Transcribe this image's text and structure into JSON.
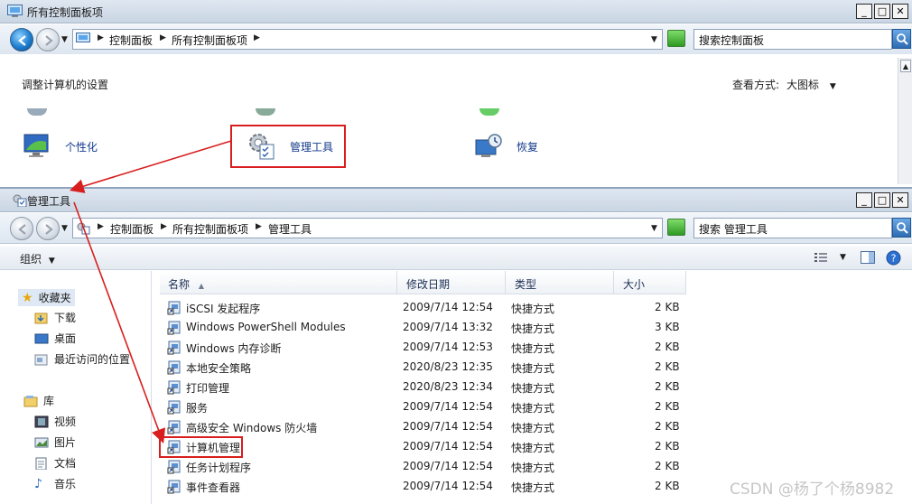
{
  "back_window": {
    "title": "所有控制面板项",
    "breadcrumb": [
      "控制面板",
      "所有控制面板项"
    ],
    "search_placeholder": "搜索控制面板",
    "heading": "调整计算机的设置",
    "view_label": "查看方式:",
    "view_value": "大图标",
    "items": [
      {
        "label": "个性化",
        "icon": "personalization-icon"
      },
      {
        "label": "管理工具",
        "icon": "admin-tools-icon"
      },
      {
        "label": "恢复",
        "icon": "recovery-icon"
      }
    ]
  },
  "front_window": {
    "title": "管理工具",
    "breadcrumb": [
      "控制面板",
      "所有控制面板项",
      "管理工具"
    ],
    "search_placeholder": "搜索 管理工具",
    "organize_label": "组织",
    "nav": {
      "favorites": "收藏夹",
      "favorite_items": [
        "下载",
        "桌面",
        "最近访问的位置"
      ],
      "library": "库",
      "library_items": [
        "视频",
        "图片",
        "文档",
        "音乐"
      ]
    },
    "columns": {
      "name": "名称",
      "modified": "修改日期",
      "type": "类型",
      "size": "大小"
    },
    "files": [
      {
        "name": "iSCSI 发起程序",
        "modified": "2009/7/14 12:54",
        "type": "快捷方式",
        "size": "2 KB"
      },
      {
        "name": "Windows PowerShell Modules",
        "modified": "2009/7/14 13:32",
        "type": "快捷方式",
        "size": "3 KB"
      },
      {
        "name": "Windows 内存诊断",
        "modified": "2009/7/14 12:53",
        "type": "快捷方式",
        "size": "2 KB"
      },
      {
        "name": "本地安全策略",
        "modified": "2020/8/23 12:35",
        "type": "快捷方式",
        "size": "2 KB"
      },
      {
        "name": "打印管理",
        "modified": "2020/8/23 12:34",
        "type": "快捷方式",
        "size": "2 KB"
      },
      {
        "name": "服务",
        "modified": "2009/7/14 12:54",
        "type": "快捷方式",
        "size": "2 KB"
      },
      {
        "name": "高级安全 Windows 防火墙",
        "modified": "2009/7/14 12:54",
        "type": "快捷方式",
        "size": "2 KB"
      },
      {
        "name": "计算机管理",
        "modified": "2009/7/14 12:54",
        "type": "快捷方式",
        "size": "2 KB"
      },
      {
        "name": "任务计划程序",
        "modified": "2009/7/14 12:54",
        "type": "快捷方式",
        "size": "2 KB"
      },
      {
        "name": "事件查看器",
        "modified": "2009/7/14 12:54",
        "type": "快捷方式",
        "size": "2 KB"
      }
    ]
  },
  "watermark": "CSDN @杨了个杨8982",
  "colors": {
    "highlight": "#d81e1e",
    "link": "#123a8c"
  }
}
